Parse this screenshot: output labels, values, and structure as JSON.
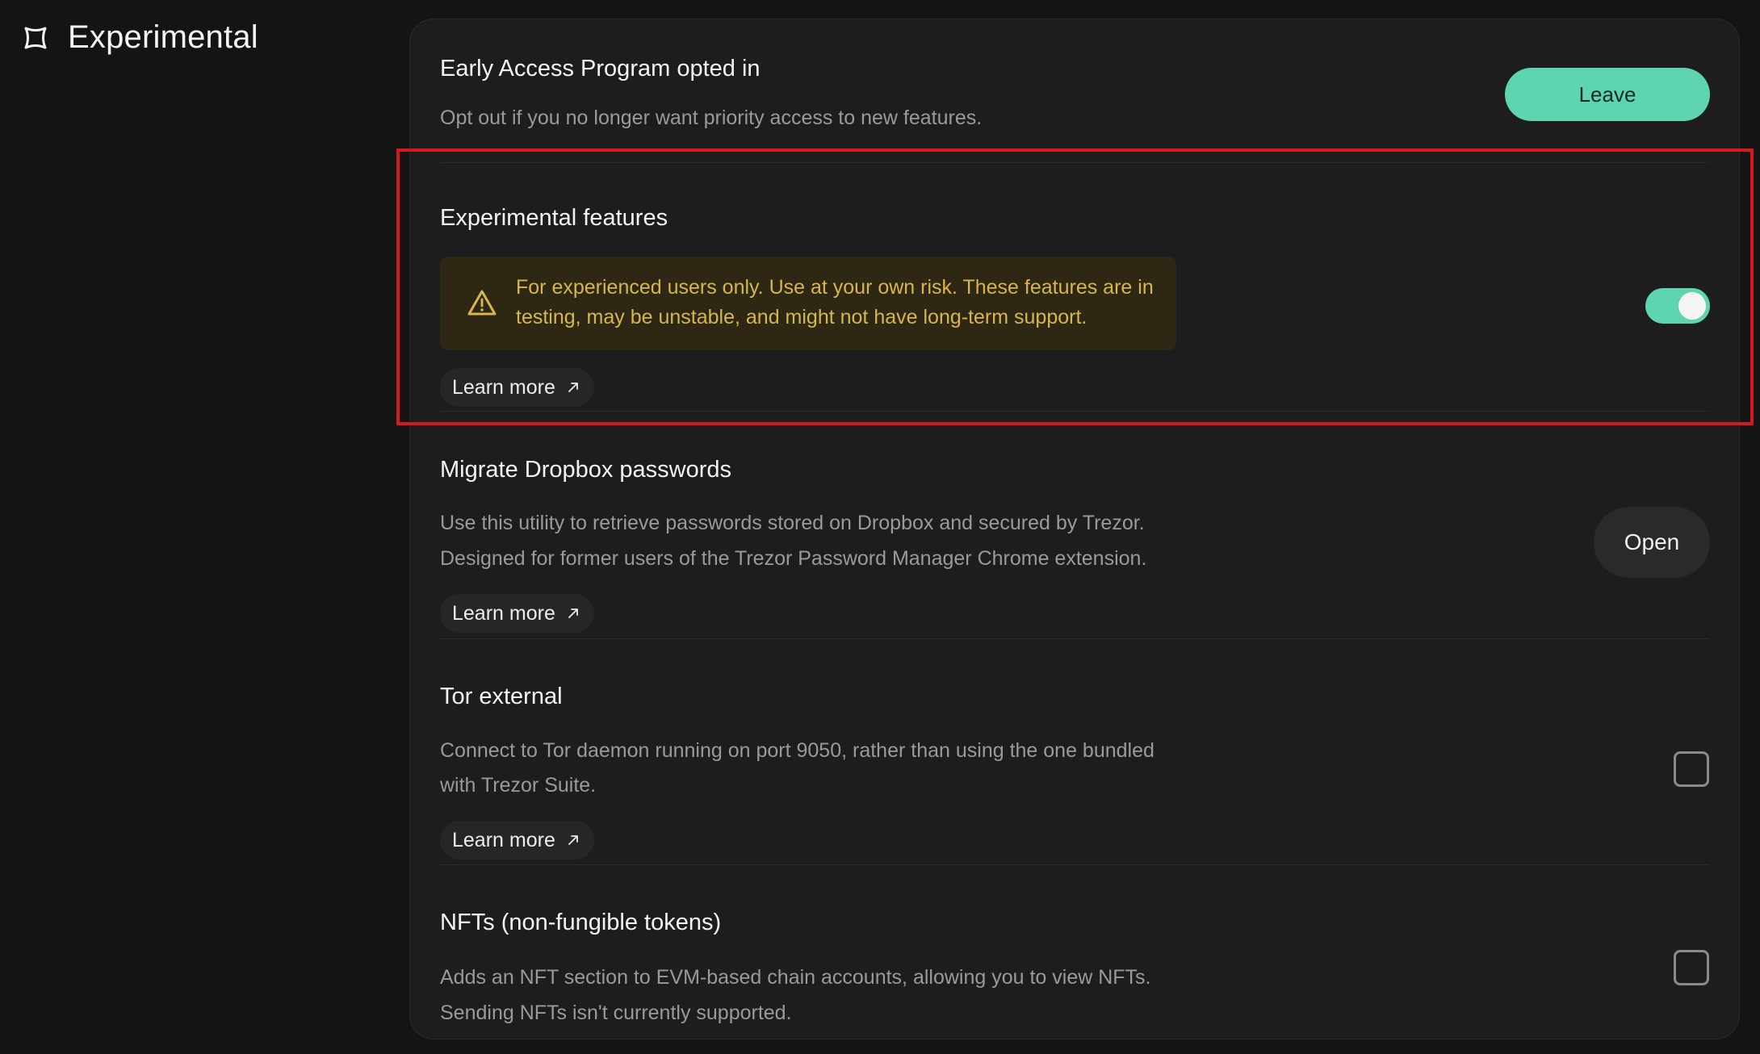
{
  "section": {
    "title": "Experimental",
    "icon": "experimental-icon"
  },
  "rows": {
    "early_access": {
      "title": "Early Access Program opted in",
      "description": "Opt out if you no longer want priority access to new features.",
      "button_label": "Leave"
    },
    "experimental_features": {
      "title": "Experimental features",
      "warning": "For experienced users only. Use at your own risk. These features are in testing, may be unstable, and might not have long-term support.",
      "learn_more": "Learn more",
      "toggle_on": true
    },
    "dropbox": {
      "title": "Migrate Dropbox passwords",
      "description_line1": "Use this utility to retrieve passwords stored on Dropbox and secured by Trezor.",
      "description_line2": "Designed for former users of the Trezor Password Manager Chrome extension.",
      "learn_more": "Learn more",
      "button_label": "Open"
    },
    "tor": {
      "title": "Tor external",
      "description_line1": "Connect to Tor daemon running on port 9050, rather than using the one bundled",
      "description_line2": "with Trezor Suite.",
      "learn_more": "Learn more",
      "checked": false
    },
    "nfts": {
      "title": "NFTs (non-fungible tokens)",
      "description_line1": "Adds an NFT section to EVM-based chain accounts, allowing you to view NFTs.",
      "description_line2": "Sending NFTs isn't currently supported.",
      "checked": false
    }
  },
  "colors": {
    "background": "#141414",
    "card": "#1d1d1d",
    "accent": "#5fd4b0",
    "warning_bg": "#2d2714",
    "warning_text": "#d7b64c",
    "highlight": "#d4181b"
  }
}
